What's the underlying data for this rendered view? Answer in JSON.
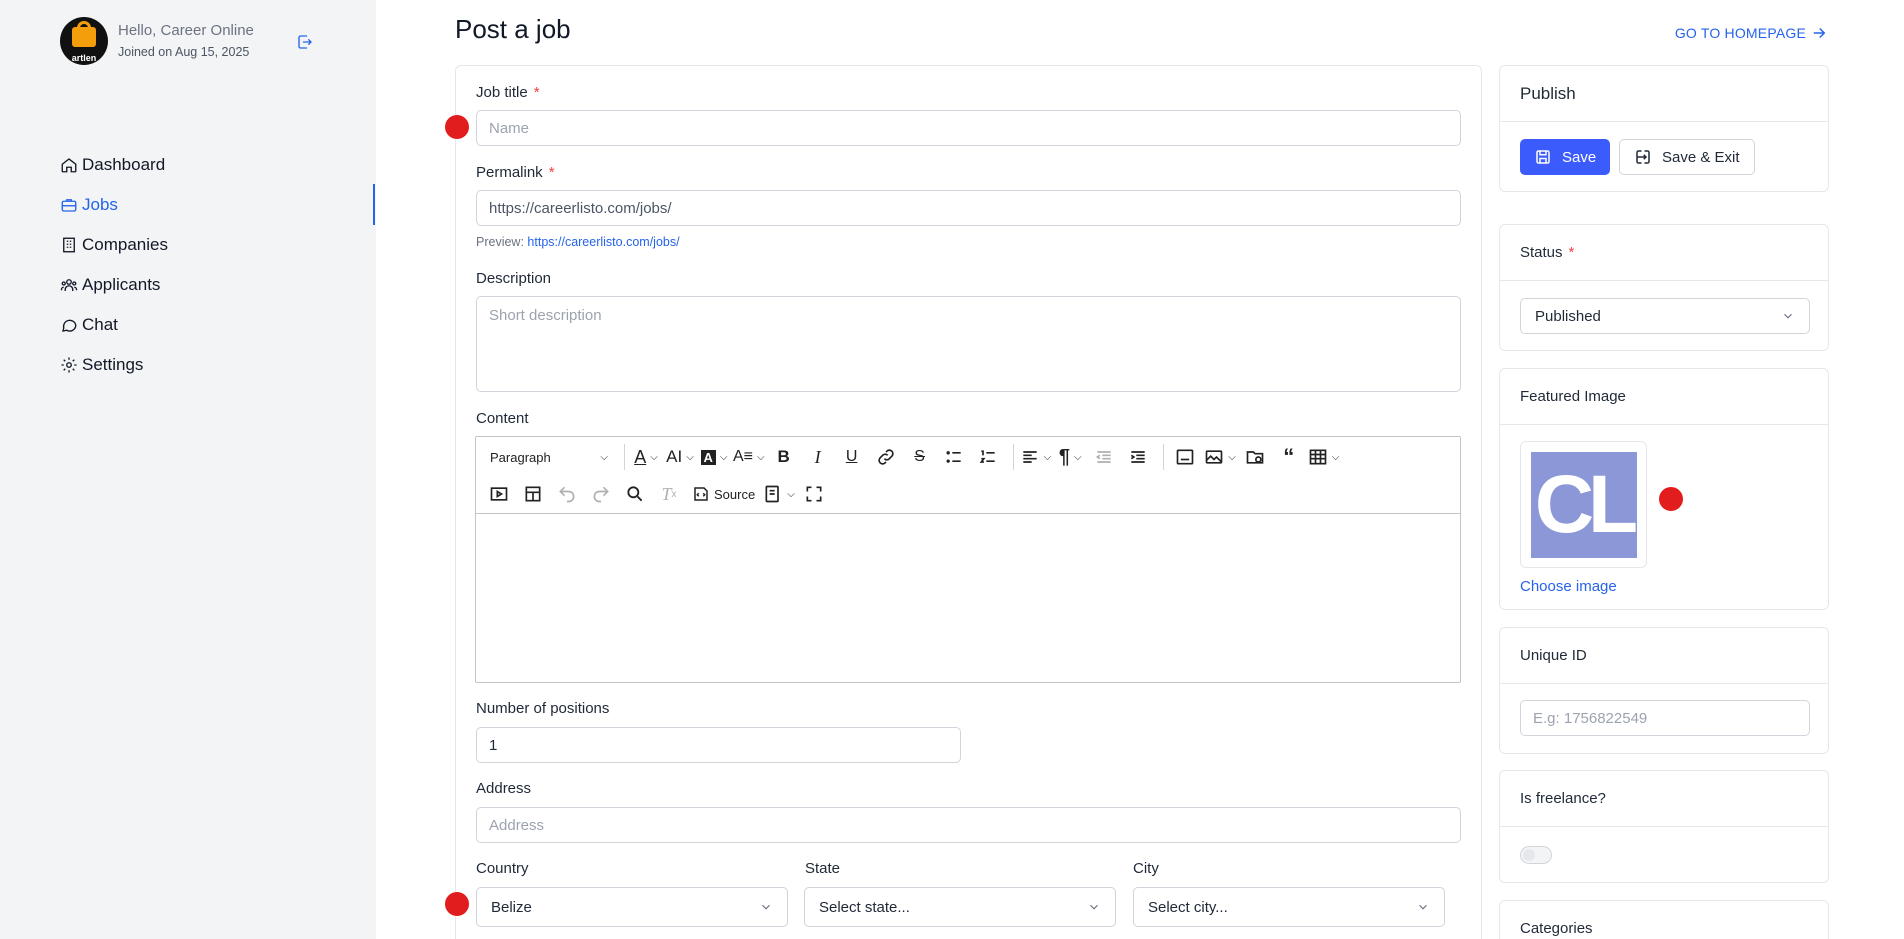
{
  "user": {
    "greeting": "Hello, Career Online",
    "joined": "Joined on Aug 15, 2025",
    "avatar_text": "artlen"
  },
  "nav": {
    "items": [
      {
        "label": "Dashboard",
        "icon": "home-icon"
      },
      {
        "label": "Jobs",
        "icon": "briefcase-icon",
        "active": true
      },
      {
        "label": "Companies",
        "icon": "building-icon"
      },
      {
        "label": "Applicants",
        "icon": "users-icon"
      },
      {
        "label": "Chat",
        "icon": "chat-icon"
      },
      {
        "label": "Settings",
        "icon": "gear-icon"
      }
    ]
  },
  "header": {
    "title": "Post a job",
    "home_link": "GO TO HOMEPAGE"
  },
  "form": {
    "job_title": {
      "label": "Job title",
      "placeholder": "Name"
    },
    "permalink": {
      "label": "Permalink",
      "value": "https://careerlisto.com/jobs/",
      "preview_label": "Preview:",
      "preview_url": "https://careerlisto.com/jobs/"
    },
    "description": {
      "label": "Description",
      "placeholder": "Short description"
    },
    "content": {
      "label": "Content",
      "paragraph_select": "Paragraph",
      "source_label": "Source"
    },
    "positions": {
      "label": "Number of positions",
      "value": "1"
    },
    "address": {
      "label": "Address",
      "placeholder": "Address"
    },
    "country": {
      "label": "Country",
      "value": "Belize"
    },
    "state": {
      "label": "State",
      "value": "Select state..."
    },
    "city": {
      "label": "City",
      "value": "Select city..."
    }
  },
  "sidebar_right": {
    "publish": {
      "title": "Publish",
      "save": "Save",
      "save_exit": "Save & Exit"
    },
    "status": {
      "label": "Status",
      "value": "Published"
    },
    "featured_image": {
      "label": "Featured Image",
      "thumb_text": "CL",
      "choose": "Choose image"
    },
    "unique_id": {
      "label": "Unique ID",
      "placeholder": "E.g: 1756822549"
    },
    "freelance": {
      "label": "Is freelance?"
    },
    "categories": {
      "label": "Categories"
    }
  },
  "colors": {
    "accent": "#2563eb",
    "primary_button": "#3b5bfd",
    "required": "#ef4444",
    "marker": "#e11d1d"
  }
}
